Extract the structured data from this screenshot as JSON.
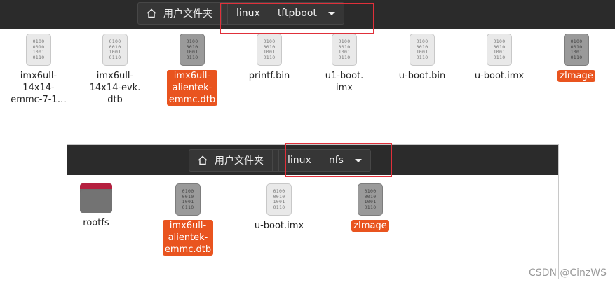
{
  "top_window": {
    "breadcrumb": {
      "home_label": "用户文件夹",
      "parent": "linux",
      "current": "tftpboot"
    },
    "files": [
      {
        "name": "imx6ull-\n14x14-\nemmc-7-1…",
        "selected": false,
        "style": "light"
      },
      {
        "name": "imx6ull-\n14x14-evk.\ndtb",
        "selected": false,
        "style": "light"
      },
      {
        "name": "imx6ull-\nalientek-\nemmc.dtb",
        "selected": true,
        "style": "dark"
      },
      {
        "name": "printf.bin",
        "selected": false,
        "style": "light"
      },
      {
        "name": "u1-boot.\nimx",
        "selected": false,
        "style": "light"
      },
      {
        "name": "u-boot.bin",
        "selected": false,
        "style": "light"
      },
      {
        "name": "u-boot.imx",
        "selected": false,
        "style": "light"
      },
      {
        "name": "zImage",
        "selected": true,
        "style": "dark"
      }
    ]
  },
  "bottom_window": {
    "breadcrumb": {
      "home_label": "用户文件夹",
      "parent": "linux",
      "current": "nfs"
    },
    "files": [
      {
        "name": "rootfs",
        "type": "folder",
        "selected": false
      },
      {
        "name": "imx6ull-\nalientek-\nemmc.dtb",
        "type": "file",
        "selected": true,
        "style": "dark"
      },
      {
        "name": "u-boot.imx",
        "type": "file",
        "selected": false,
        "style": "light"
      },
      {
        "name": "zImage",
        "type": "file",
        "selected": true,
        "style": "dark"
      }
    ]
  },
  "binary_glyph": [
    "0100",
    "0010",
    "1001",
    "0110"
  ],
  "watermark": "CSDN @CinzWS",
  "colors": {
    "toolbar": "#2b2b2b",
    "selection": "#e9541f",
    "highlight_box": "#e0303a",
    "folder_tab": "#b5203f"
  }
}
